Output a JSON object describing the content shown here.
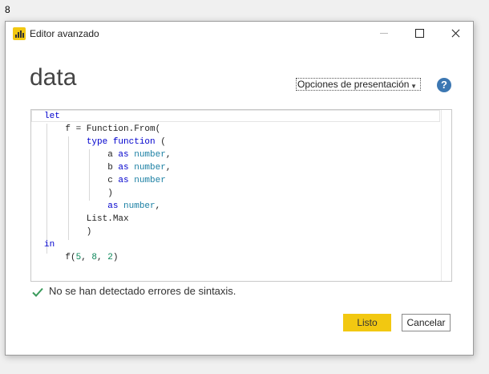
{
  "background_label": "8",
  "window": {
    "title": "Editor avanzado"
  },
  "query_name": "data",
  "toolbar": {
    "display_options_label": "Opciones de presentación",
    "help_label": "?"
  },
  "editor": {
    "code_lines": [
      [
        {
          "t": "let",
          "c": "kw"
        }
      ],
      [
        {
          "t": "    f = Function.From(",
          "c": ""
        }
      ],
      [
        {
          "t": "        ",
          "c": ""
        },
        {
          "t": "type",
          "c": "kw"
        },
        {
          "t": " ",
          "c": ""
        },
        {
          "t": "function",
          "c": "kw"
        },
        {
          "t": " (",
          "c": ""
        }
      ],
      [
        {
          "t": "            a ",
          "c": ""
        },
        {
          "t": "as",
          "c": "kw"
        },
        {
          "t": " ",
          "c": ""
        },
        {
          "t": "number",
          "c": "tp"
        },
        {
          "t": ",",
          "c": ""
        }
      ],
      [
        {
          "t": "            b ",
          "c": ""
        },
        {
          "t": "as",
          "c": "kw"
        },
        {
          "t": " ",
          "c": ""
        },
        {
          "t": "number",
          "c": "tp"
        },
        {
          "t": ",",
          "c": ""
        }
      ],
      [
        {
          "t": "            c ",
          "c": ""
        },
        {
          "t": "as",
          "c": "kw"
        },
        {
          "t": " ",
          "c": ""
        },
        {
          "t": "number",
          "c": "tp"
        }
      ],
      [
        {
          "t": "            )",
          "c": ""
        }
      ],
      [
        {
          "t": "            ",
          "c": ""
        },
        {
          "t": "as",
          "c": "kw"
        },
        {
          "t": " ",
          "c": ""
        },
        {
          "t": "number",
          "c": "tp"
        },
        {
          "t": ",",
          "c": ""
        }
      ],
      [
        {
          "t": "        List.Max",
          "c": ""
        }
      ],
      [
        {
          "t": "        )",
          "c": ""
        }
      ],
      [
        {
          "t": "in",
          "c": "kw"
        }
      ],
      [
        {
          "t": "    f(",
          "c": ""
        },
        {
          "t": "5",
          "c": "nm"
        },
        {
          "t": ", ",
          "c": ""
        },
        {
          "t": "8",
          "c": "nm"
        },
        {
          "t": ", ",
          "c": ""
        },
        {
          "t": "2",
          "c": "nm"
        },
        {
          "t": ")",
          "c": ""
        }
      ]
    ]
  },
  "status": {
    "icon": "checkmark-icon",
    "message": "No se han detectado errores de sintaxis."
  },
  "buttons": {
    "ok_label": "Listo",
    "cancel_label": "Cancelar"
  },
  "colors": {
    "accent": "#f2c811",
    "help": "#3c77b2",
    "success": "#3a9a5b",
    "keyword": "#0000cd",
    "type": "#1a7fa3",
    "number": "#098658"
  }
}
